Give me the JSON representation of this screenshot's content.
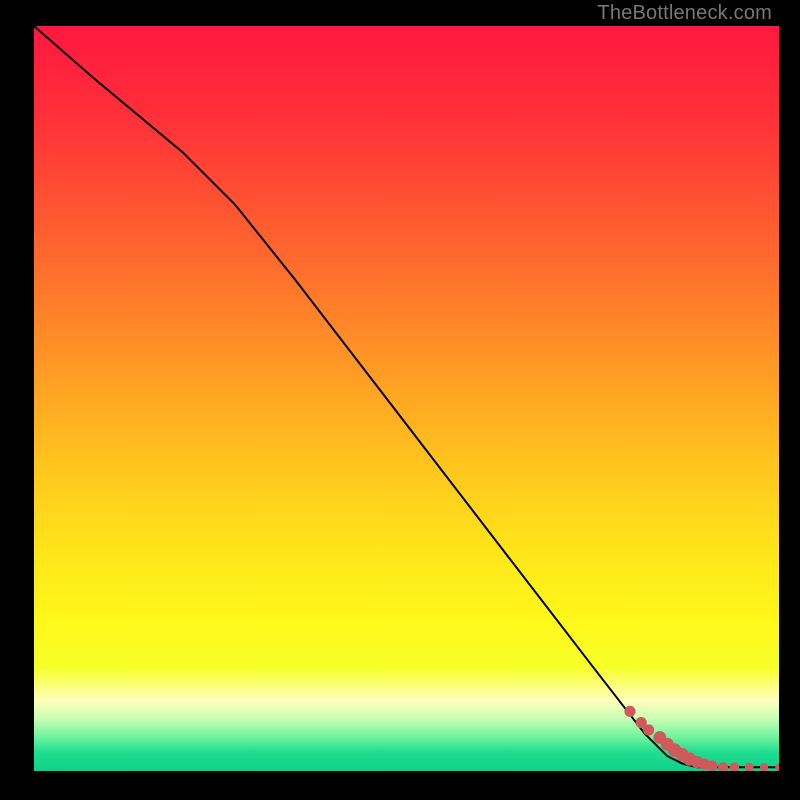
{
  "attribution": "TheBottleneck.com",
  "colors": {
    "marker": "#d0595b",
    "line": "#000000",
    "frame_bg": "#000000"
  },
  "chart_data": {
    "type": "line",
    "title": "",
    "xlabel": "",
    "ylabel": "",
    "xlim": [
      0,
      100
    ],
    "ylim": [
      0,
      100
    ],
    "grid": false,
    "legend": false,
    "gradient_stops": [
      {
        "offset": 0.0,
        "color": "#ff183f"
      },
      {
        "offset": 0.12,
        "color": "#ff2f39"
      },
      {
        "offset": 0.28,
        "color": "#ff5f2f"
      },
      {
        "offset": 0.44,
        "color": "#ff9326"
      },
      {
        "offset": 0.58,
        "color": "#ffc21e"
      },
      {
        "offset": 0.7,
        "color": "#ffe41a"
      },
      {
        "offset": 0.8,
        "color": "#fff81a"
      },
      {
        "offset": 0.86,
        "color": "#f6ff27"
      },
      {
        "offset": 0.905,
        "color": "#ffffbb"
      },
      {
        "offset": 0.93,
        "color": "#c8ffb4"
      },
      {
        "offset": 0.955,
        "color": "#6cf39e"
      },
      {
        "offset": 0.975,
        "color": "#20dd8f"
      },
      {
        "offset": 1.0,
        "color": "#0fd189"
      }
    ],
    "series": [
      {
        "name": "trace",
        "x": [
          0,
          8,
          20,
          27,
          35,
          45,
          55,
          65,
          75,
          82,
          85,
          87,
          89,
          92,
          96,
          100
        ],
        "y": [
          100,
          93,
          83,
          76,
          66,
          53,
          40,
          27,
          14,
          5,
          2,
          1,
          0.5,
          0.5,
          0.5,
          0.5
        ]
      }
    ],
    "markers": {
      "name": "points",
      "x": [
        80,
        81.5,
        82.5,
        84,
        85,
        86,
        87,
        88,
        89,
        90,
        91,
        92.5,
        94,
        96,
        98,
        100
      ],
      "y": [
        8,
        6.5,
        5.5,
        4.5,
        3.6,
        2.8,
        2.2,
        1.6,
        1.2,
        0.9,
        0.7,
        0.5,
        0.5,
        0.5,
        0.5,
        0.5
      ],
      "r": [
        3.5,
        3.5,
        3.5,
        4,
        4,
        4.2,
        4.2,
        4.2,
        3.8,
        3.6,
        3.4,
        3.2,
        3.0,
        2.8,
        2.6,
        2.4
      ]
    }
  }
}
